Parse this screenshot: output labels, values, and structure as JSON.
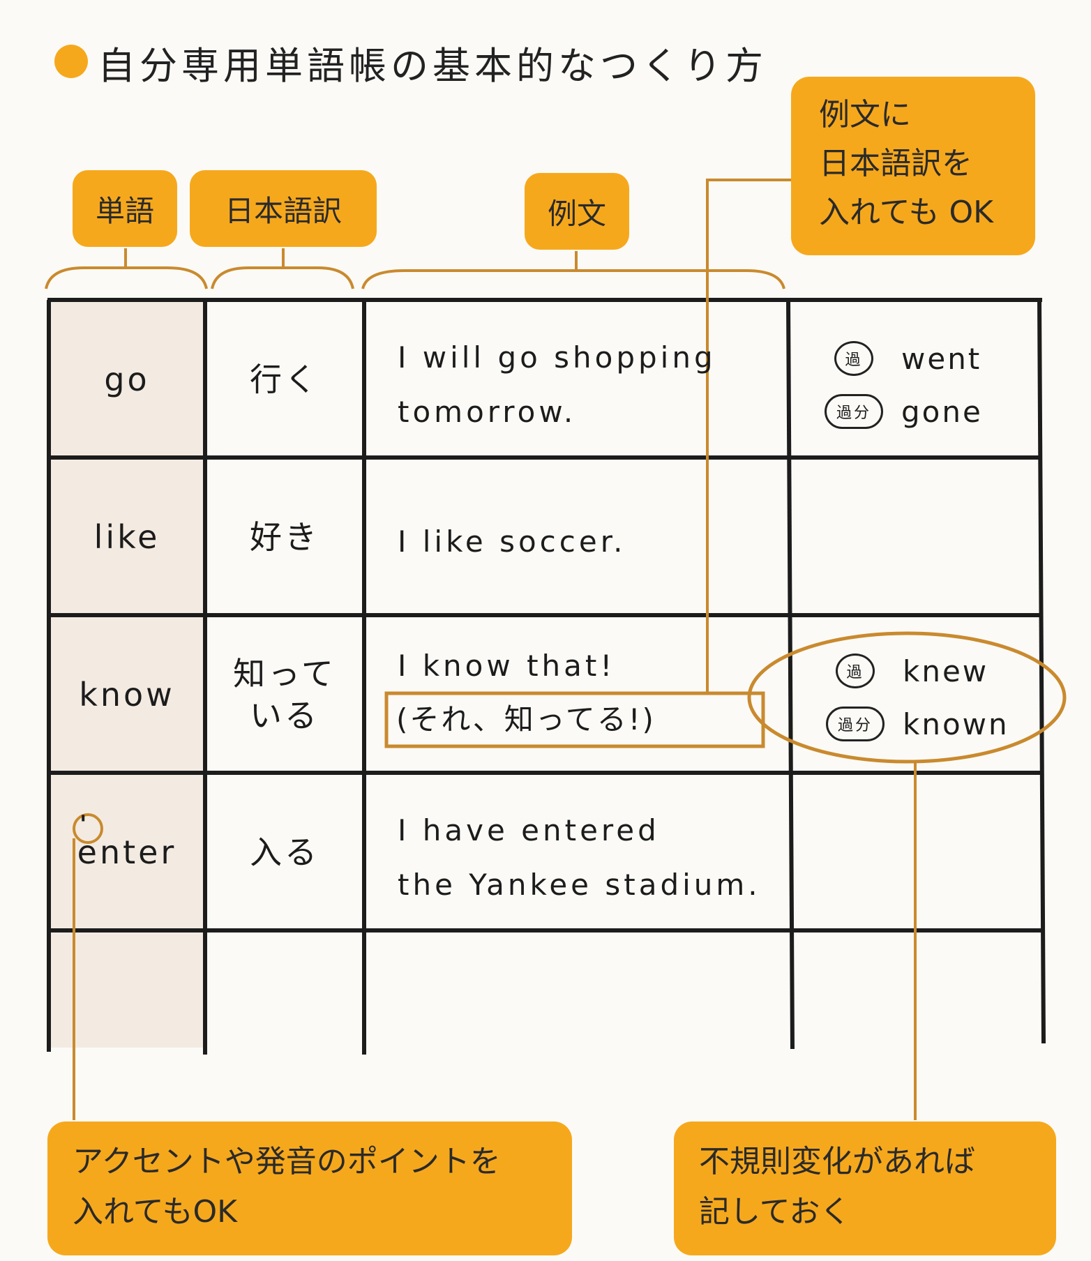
{
  "title": "自分専用単語帳の基本的なつくり方",
  "headers": {
    "word": "単語",
    "japanese": "日本語訳",
    "example": "例文"
  },
  "notes": {
    "example_translation": "例文に\n日本語訳を\n入れても OK",
    "accent": "アクセントや発音のポイントを\n入れてもOK",
    "irregular": "不規則変化があれば\n記しておく"
  },
  "badges": {
    "past": "過",
    "past_participle": "過分"
  },
  "rows": [
    {
      "word": "go",
      "japanese": "行く",
      "example": "I will go shopping\ntomorrow.",
      "past": "went",
      "past_participle": "gone"
    },
    {
      "word": "like",
      "japanese": "好き",
      "example": "I like soccer."
    },
    {
      "word": "know",
      "japanese": "知って\nいる",
      "example": "I know that!",
      "example_translation": "(それ、知ってる!)",
      "past": "knew",
      "past_participle": "known"
    },
    {
      "word": "enter",
      "accent_mark": "'",
      "japanese": "入る",
      "example": "I have entered\nthe Yankee stadium."
    }
  ],
  "colors": {
    "accent": "#f6a81c",
    "line": "#c98a2e",
    "grid": "#1c1c1c"
  }
}
